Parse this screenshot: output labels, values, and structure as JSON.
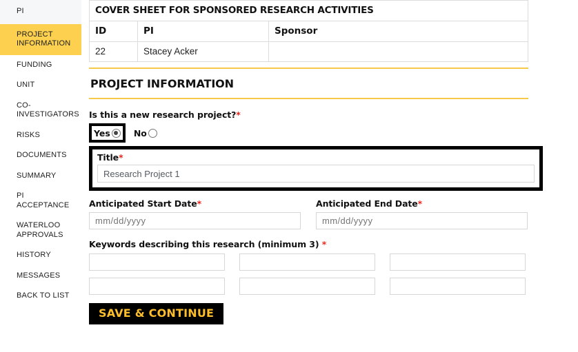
{
  "sidebar": {
    "items": [
      {
        "label": "PI",
        "state": "visited"
      },
      {
        "label": "PROJECT INFORMATION",
        "state": "active"
      },
      {
        "label": "FUNDING",
        "state": "default"
      },
      {
        "label": "UNIT",
        "state": "default"
      },
      {
        "label": "CO-INVESTIGATORS",
        "state": "default"
      },
      {
        "label": "RISKS",
        "state": "default"
      },
      {
        "label": "DOCUMENTS",
        "state": "default"
      },
      {
        "label": "SUMMARY",
        "state": "default"
      },
      {
        "label": "PI ACCEPTANCE",
        "state": "default"
      },
      {
        "label": "WATERLOO APPROVALS",
        "state": "default"
      },
      {
        "label": "HISTORY",
        "state": "default"
      },
      {
        "label": "MESSAGES",
        "state": "default"
      },
      {
        "label": "BACK TO LIST",
        "state": "default"
      }
    ]
  },
  "cover_table": {
    "caption": "COVER SHEET FOR SPONSORED RESEARCH ACTIVITIES",
    "columns": [
      "ID",
      "PI",
      "Sponsor"
    ],
    "rows": [
      {
        "id": "22",
        "pi": "Stacey Acker",
        "sponsor": ""
      }
    ]
  },
  "section": {
    "heading": "PROJECT INFORMATION"
  },
  "form": {
    "new_project": {
      "label": "Is this a new research project?",
      "required_mark": "*",
      "options": [
        {
          "label": "Yes",
          "checked": true
        },
        {
          "label": "No",
          "checked": false
        }
      ]
    },
    "title": {
      "label": "Title",
      "required_mark": "*",
      "value": "Research Project 1",
      "placeholder": ""
    },
    "start_date": {
      "label": "Anticipated Start Date",
      "required_mark": "*",
      "value": "",
      "placeholder": "mm/dd/yyyy"
    },
    "end_date": {
      "label": "Anticipated End Date",
      "required_mark": "*",
      "value": "",
      "placeholder": "mm/dd/yyyy"
    },
    "keywords": {
      "label": "Keywords describing this research (minimum 3) ",
      "required_mark": "*",
      "values": [
        "",
        "",
        "",
        "",
        "",
        ""
      ]
    },
    "submit": {
      "label": "SAVE & CONTINUE"
    }
  },
  "colors": {
    "accent_yellow": "#fdd14f",
    "rule_gold": "#f7c948",
    "button_text_gold": "#fdbe2c",
    "required_red": "#e8271c",
    "highlight_black": "#000000"
  }
}
